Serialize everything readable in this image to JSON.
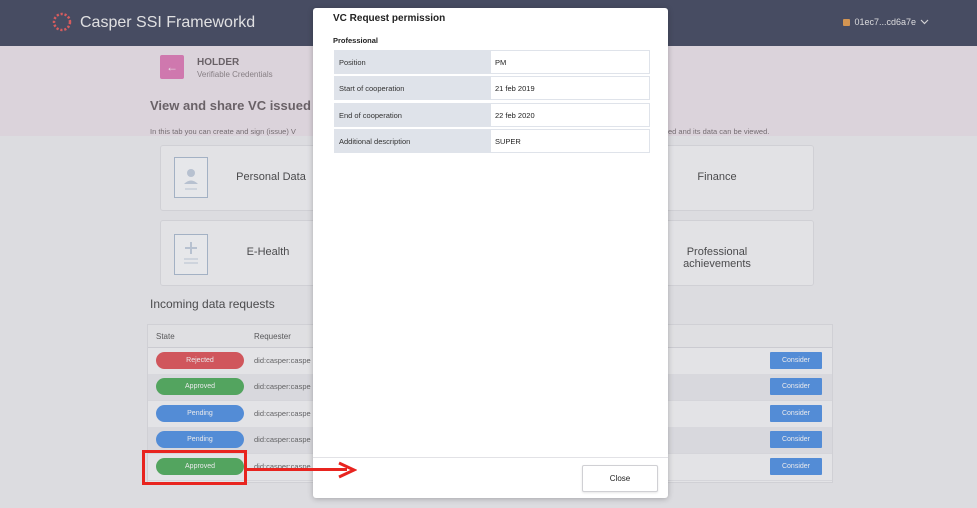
{
  "app": {
    "title": "Casper SSI Frameworkd",
    "wallet": "01ec7...cd6a7e"
  },
  "header": {
    "role_title": "HOLDER",
    "role_subtitle": "Verifiable Credentials",
    "back_symbol": "←"
  },
  "main": {
    "heading": "View and share VC issued to y",
    "description_left": "In this tab you can create and sign (issue) V",
    "description_right": "ed and its data can be viewed.",
    "cards": [
      {
        "label": "Personal Data"
      },
      {
        "label": "Finance"
      },
      {
        "label": "E-Health"
      },
      {
        "label": "Professional achievements"
      }
    ]
  },
  "requests": {
    "heading": "Incoming data requests",
    "columns": [
      "State",
      "Requester"
    ],
    "rows": [
      {
        "state": "Rejected",
        "requester": "did:casper:caspe",
        "action": "Consider"
      },
      {
        "state": "Approved",
        "requester": "did:casper:caspe",
        "action": "Consider"
      },
      {
        "state": "Pending",
        "requester": "did:casper:caspe",
        "action": "Consider"
      },
      {
        "state": "Pending",
        "requester": "did:casper:caspe",
        "action": "Consider"
      },
      {
        "state": "Approved",
        "requester": "did:casper:caspe",
        "action": "Consider"
      }
    ]
  },
  "modal": {
    "title": "VC Request permission",
    "section": "Professional",
    "fields": [
      {
        "key": "Position",
        "value": "PM"
      },
      {
        "key": "Start of cooperation",
        "value": "21 feb 2019"
      },
      {
        "key": "End of cooperation",
        "value": "22 feb 2020"
      },
      {
        "key": "Additional description",
        "value": "SUPER"
      }
    ],
    "close_label": "Close"
  },
  "colors": {
    "navbar": "#1e2440",
    "accent_pink": "#d64aa0",
    "rejected": "#dc3338",
    "approved": "#2e9e3c",
    "pending": "#2f7de1",
    "annotation_red": "#e8241f"
  },
  "icons": {
    "logo": "casper-logo-icon",
    "wallet": "wallet-icon",
    "chevron": "chevron-down-icon",
    "person": "person-document-icon",
    "health": "plus-document-icon"
  }
}
